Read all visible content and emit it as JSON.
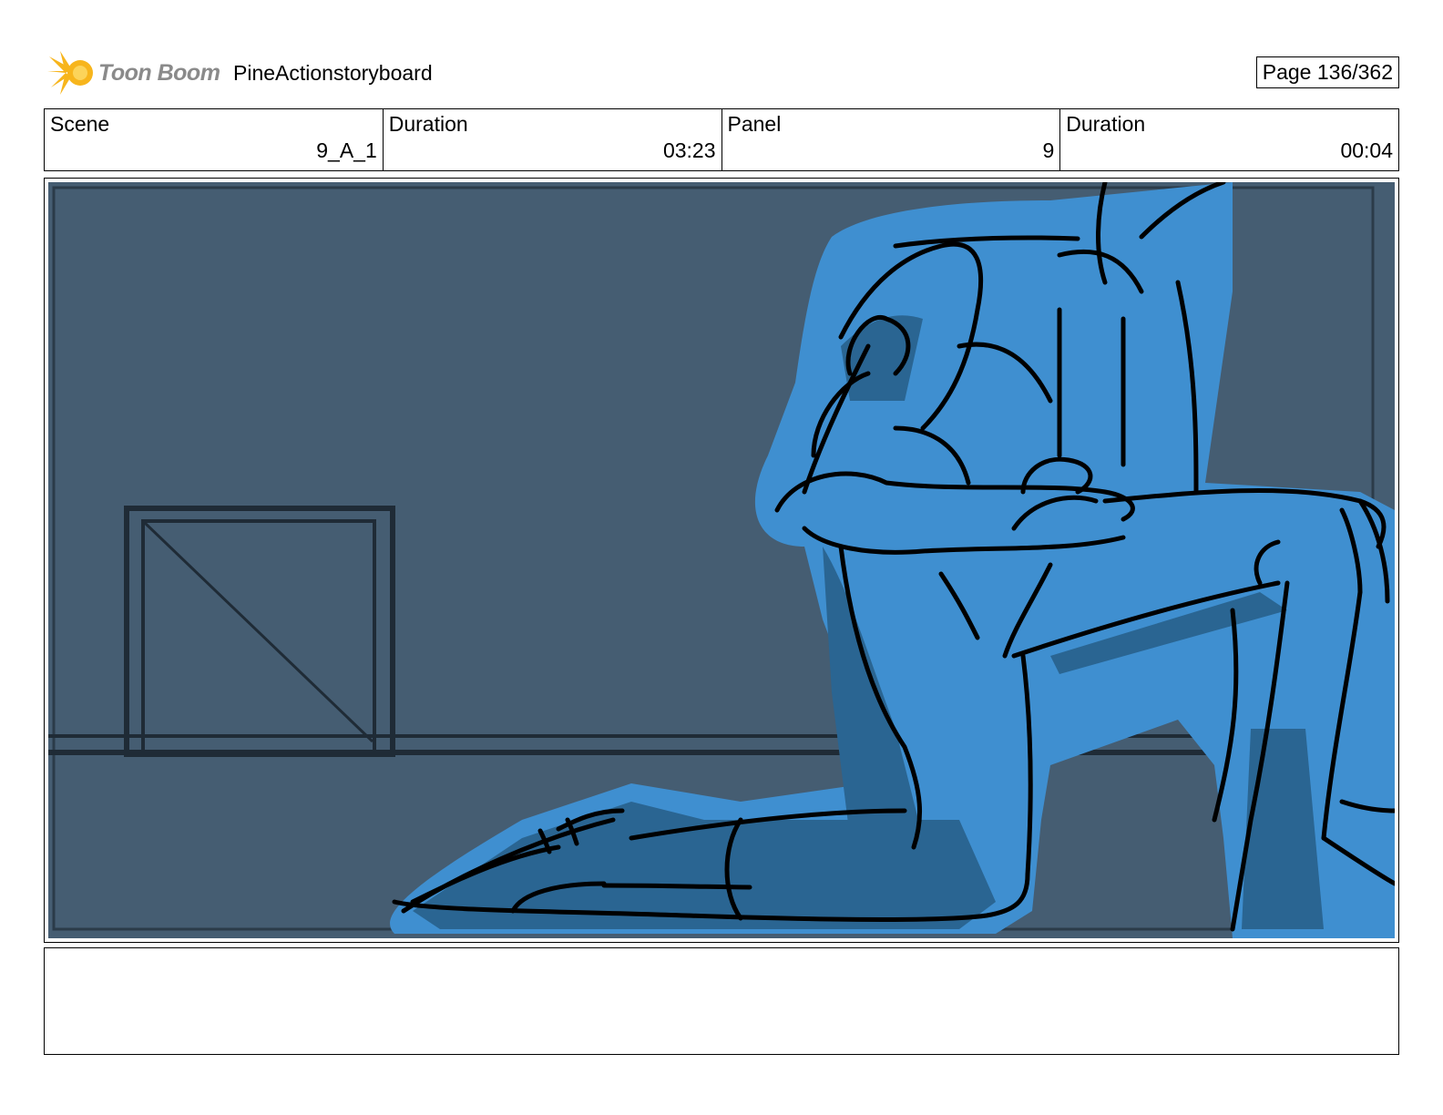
{
  "header": {
    "logo_text": "Toon Boom",
    "project_title": "PineActionstoryboard",
    "page_label": "Page 136/362"
  },
  "info": [
    {
      "label": "Scene",
      "value": "9_A_1"
    },
    {
      "label": "Duration",
      "value": "03:23"
    },
    {
      "label": "Panel",
      "value": "9"
    },
    {
      "label": "Duration",
      "value": "00:04"
    }
  ],
  "colors": {
    "background_wall": "#455d72",
    "figure_glow": "#3f8fd0",
    "figure_shadow": "#2a6592",
    "ink": "#000000",
    "logo_star": "#f7b51c"
  },
  "panel": {
    "illustration": "kneeling-figure-sketch"
  },
  "notes": {
    "text": ""
  }
}
